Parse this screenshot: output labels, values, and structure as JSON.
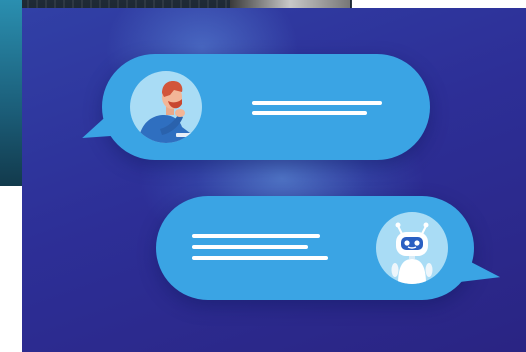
{
  "scene": {
    "colors": {
      "background_dark": "#2a2483",
      "background_light": "#3140a6",
      "bubble": "#3aa4e4",
      "avatar_bg": "#a9dcf5",
      "text_lines": "#ffffff"
    },
    "user_message": {
      "avatar_icon": "person-thinking-icon",
      "placeholder_lines": 2
    },
    "bot_message": {
      "avatar_icon": "robot-icon",
      "placeholder_lines": 3
    }
  }
}
